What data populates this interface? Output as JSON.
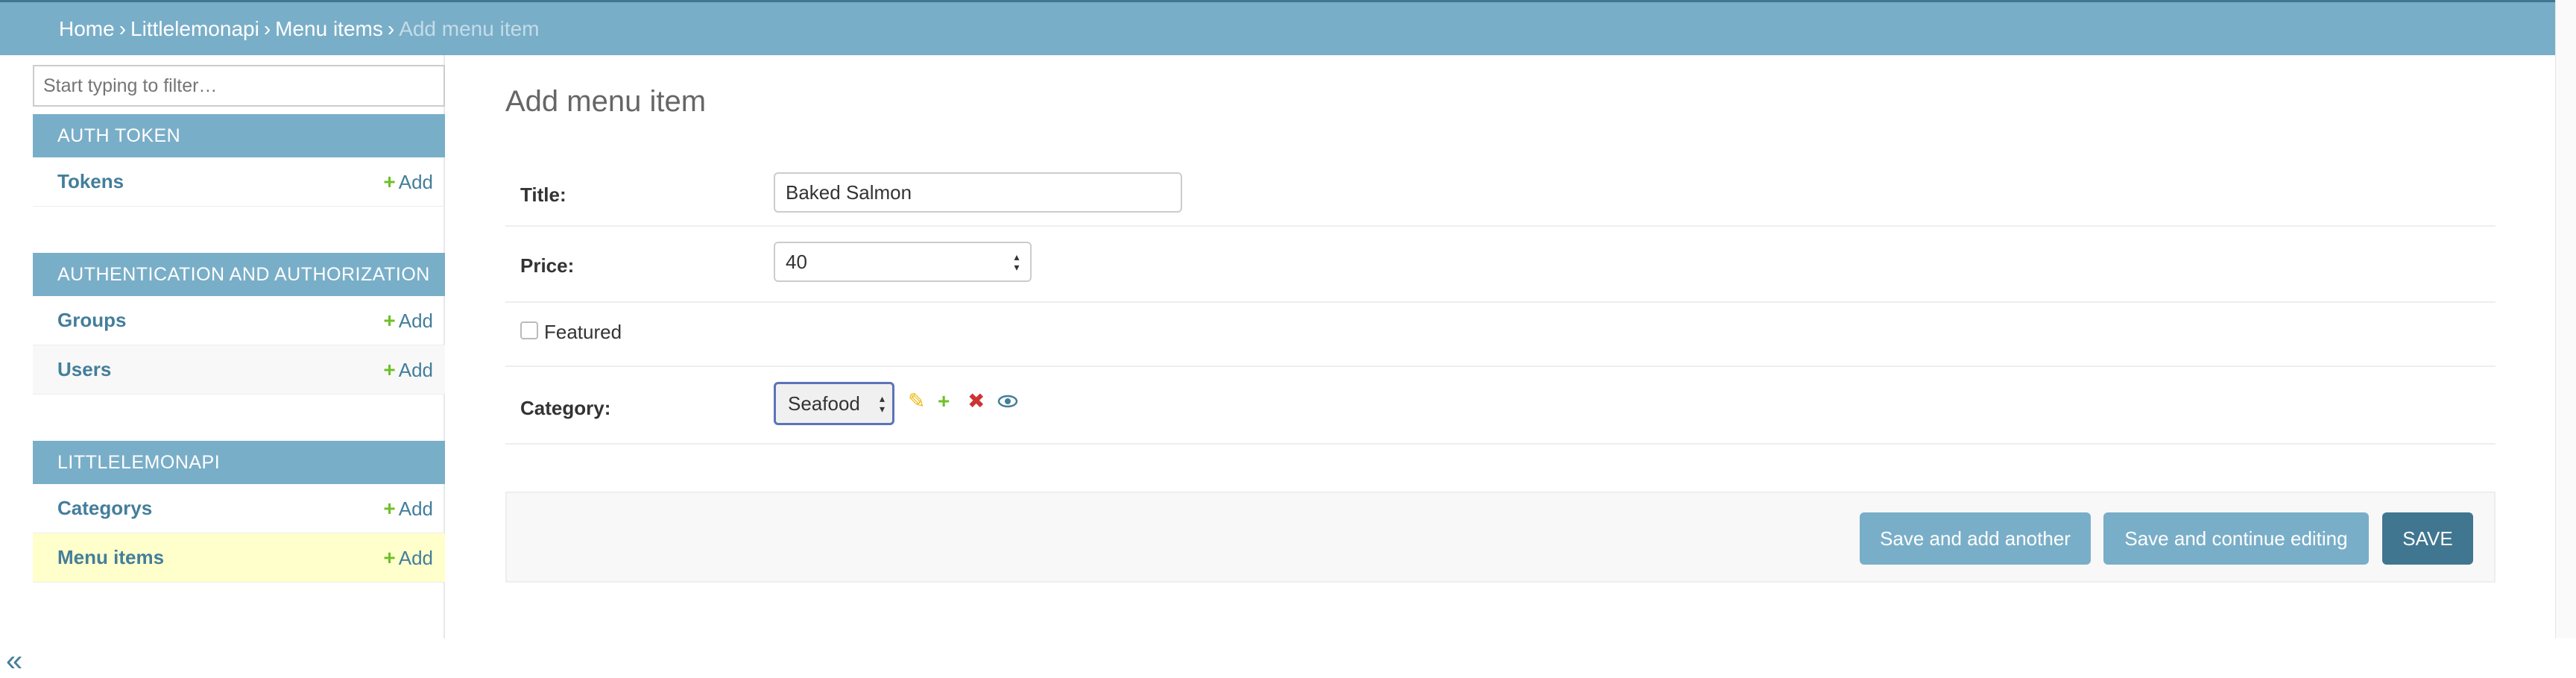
{
  "breadcrumbs": {
    "home": "Home",
    "app": "Littlelemonapi",
    "model": "Menu items",
    "current": "Add menu item",
    "separator": "›"
  },
  "sidebar": {
    "filter_placeholder": "Start typing to filter…",
    "modules": [
      {
        "caption": "AUTH TOKEN",
        "items": [
          {
            "label": "Tokens",
            "add": "Add"
          }
        ]
      },
      {
        "caption": "AUTHENTICATION AND AUTHORIZATION",
        "items": [
          {
            "label": "Groups",
            "add": "Add"
          },
          {
            "label": "Users",
            "add": "Add"
          }
        ]
      },
      {
        "caption": "LITTLELEMONAPI",
        "items": [
          {
            "label": "Categorys",
            "add": "Add"
          },
          {
            "label": "Menu items",
            "add": "Add"
          }
        ]
      }
    ],
    "collapse_icon": "«"
  },
  "form": {
    "heading": "Add menu item",
    "title_label": "Title:",
    "title_value": "Baked Salmon",
    "price_label": "Price:",
    "price_value": "40",
    "featured_label": "Featured",
    "featured_checked": false,
    "category_label": "Category:",
    "category_value": "Seafood",
    "related_icons": [
      "pencil-icon",
      "plus-icon",
      "delete-icon",
      "eye-icon"
    ]
  },
  "actions": {
    "save_add_another": "Save and add another",
    "save_continue": "Save and continue editing",
    "save": "SAVE"
  },
  "colors": {
    "header": "#79aec8",
    "header_dark": "#417690",
    "link": "#447e9b",
    "add_green": "#70bf2b",
    "current_row": "#ffffcc",
    "delete_red": "#cc3434"
  }
}
